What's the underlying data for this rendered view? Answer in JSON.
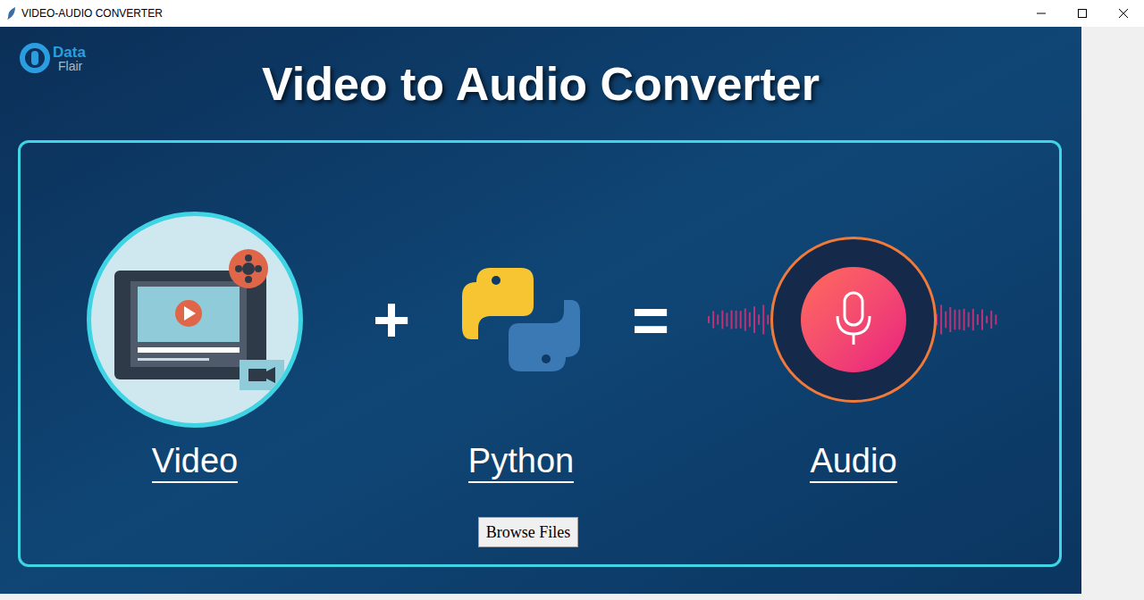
{
  "window": {
    "title": "VIDEO-AUDIO CONVERTER"
  },
  "logo": {
    "line1": "Data",
    "line2": "Flair"
  },
  "banner": {
    "title": "Video to Audio Converter"
  },
  "equation": [
    {
      "kind": "video",
      "label": "Video"
    },
    {
      "kind": "operator",
      "symbol": "+"
    },
    {
      "kind": "python",
      "label": "Python"
    },
    {
      "kind": "operator",
      "symbol": "="
    },
    {
      "kind": "audio",
      "label": "Audio"
    }
  ],
  "buttons": [
    "Browse Files"
  ]
}
